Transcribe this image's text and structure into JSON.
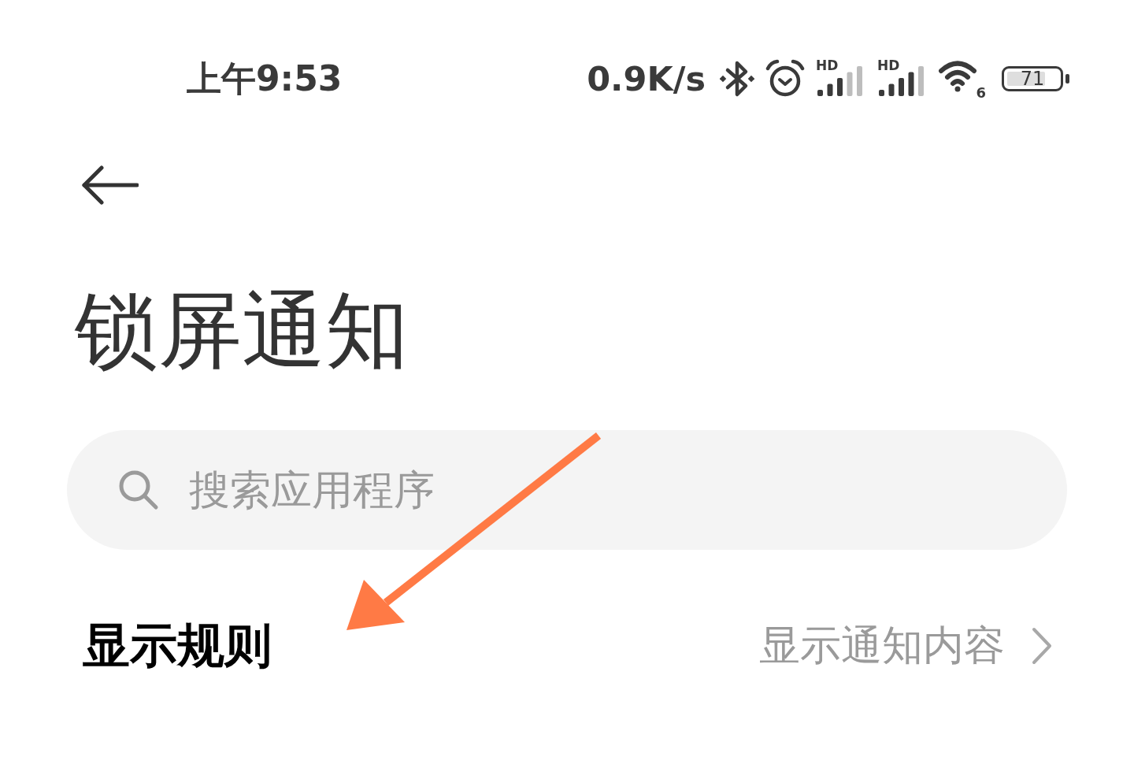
{
  "status_bar": {
    "time": "上午9:53",
    "network_speed": "0.9K/s",
    "signals": [
      {
        "label": "HD"
      },
      {
        "label": "HD"
      }
    ],
    "wifi": {
      "label": "6"
    },
    "battery": {
      "label": "71"
    }
  },
  "header": {
    "title": "锁屏通知"
  },
  "search": {
    "placeholder": "搜索应用程序"
  },
  "settings": [
    {
      "label": "显示规则",
      "value": "显示通知内容"
    }
  ]
}
